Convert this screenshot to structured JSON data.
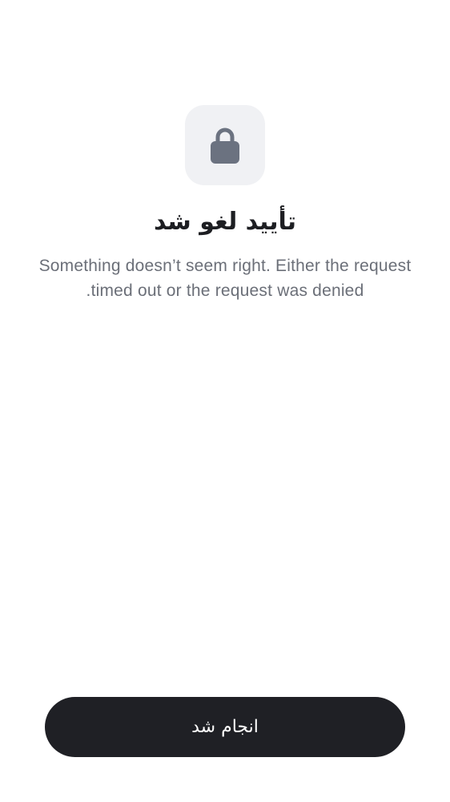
{
  "screen": {
    "icon": "lock-icon",
    "title": "تأیید لغو شد",
    "message": "Something doesn’t seem right. Either the request timed out or the request was denied.",
    "button_label": "انجام شد"
  },
  "colors": {
    "background": "#ffffff",
    "icon_tile": "#f0f1f4",
    "icon": "#6b7280",
    "title": "#1d1e22",
    "message": "#6b6f78",
    "button_bg": "#1f2025",
    "button_text": "#ffffff"
  }
}
